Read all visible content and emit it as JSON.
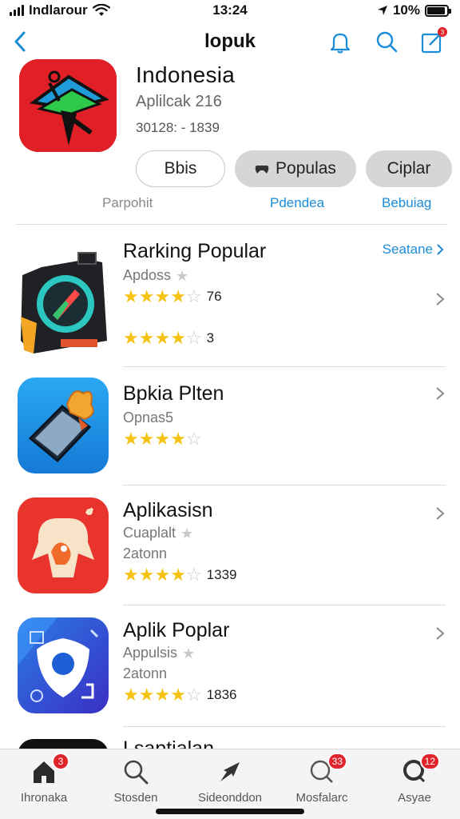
{
  "status_bar": {
    "carrier": "Indlarour",
    "time": "13:24",
    "battery": "10%",
    "battery_level": 0.9
  },
  "nav": {
    "title": "lopuk"
  },
  "header": {
    "title": "Indonesia",
    "subtitle": "Aplilcak 216",
    "meta": "30128: - 1839"
  },
  "segments": [
    {
      "label": "Bbis"
    },
    {
      "label": "Populas"
    },
    {
      "label": "Ciplar"
    }
  ],
  "sub_links": {
    "left": "Parpohit",
    "middle": "Pdendea",
    "right": "Bebuiag"
  },
  "section": {
    "title": "Rarking Popular",
    "see_all": "Seatane"
  },
  "apps": [
    {
      "title": "Rarking Popular",
      "sub": "Apdoss",
      "rating_a": 4,
      "count_a": "76",
      "rating_b": 4,
      "count_b": "3"
    },
    {
      "title": "Bpkia Plten",
      "sub": "Opnas5",
      "rating": 4
    },
    {
      "title": "Aplikasisn",
      "sub": "Cuaplalt",
      "sub2": "2atonn",
      "rating": 4,
      "count": "1339"
    },
    {
      "title": "Aplik Poplar",
      "sub": "Appulsis",
      "sub2": "2atonn",
      "rating": 4,
      "count": "1836"
    },
    {
      "title": "Lsaptialan"
    }
  ],
  "tabs": [
    {
      "label": "Ihronaka",
      "badge": "3"
    },
    {
      "label": "Stosden",
      "badge": ""
    },
    {
      "label": "Sideonddon",
      "badge": ""
    },
    {
      "label": "Mosfalarc",
      "badge": "33"
    },
    {
      "label": "Asyae",
      "badge": "12"
    }
  ],
  "colors": {
    "accent": "#1a8cd8",
    "star": "#f6c315",
    "badge": "#e0242b"
  }
}
